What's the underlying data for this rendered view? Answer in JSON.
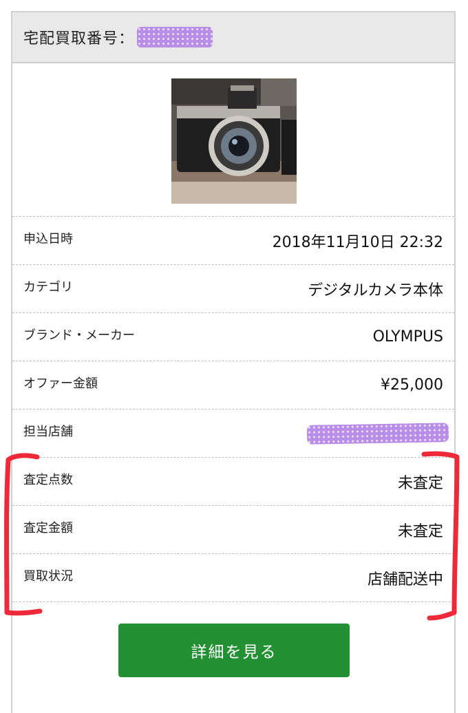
{
  "header": {
    "title": "宅配買取番号："
  },
  "photo": {
    "icon": "camera-photo"
  },
  "details": [
    {
      "label": "申込日時",
      "value": "2018年11月10日 22:32"
    },
    {
      "label": "カテゴリ",
      "value": "デジタルカメラ本体"
    },
    {
      "label": "ブランド・メーカー",
      "value": "OLYMPUS"
    },
    {
      "label": "オファー金額",
      "value": "¥25,000"
    },
    {
      "label": "担当店舗",
      "value": ""
    },
    {
      "label": "査定点数",
      "value": "未査定"
    },
    {
      "label": "査定金額",
      "value": "未査定"
    },
    {
      "label": "買取状況",
      "value": "店舗配送中"
    }
  ],
  "button": {
    "label": "詳細を見る"
  },
  "colors": {
    "button_green": "#239133",
    "annotation_red": "#ee2a3a",
    "redaction_purple": "#b98ee6",
    "header_bg": "#e9e9e9"
  }
}
